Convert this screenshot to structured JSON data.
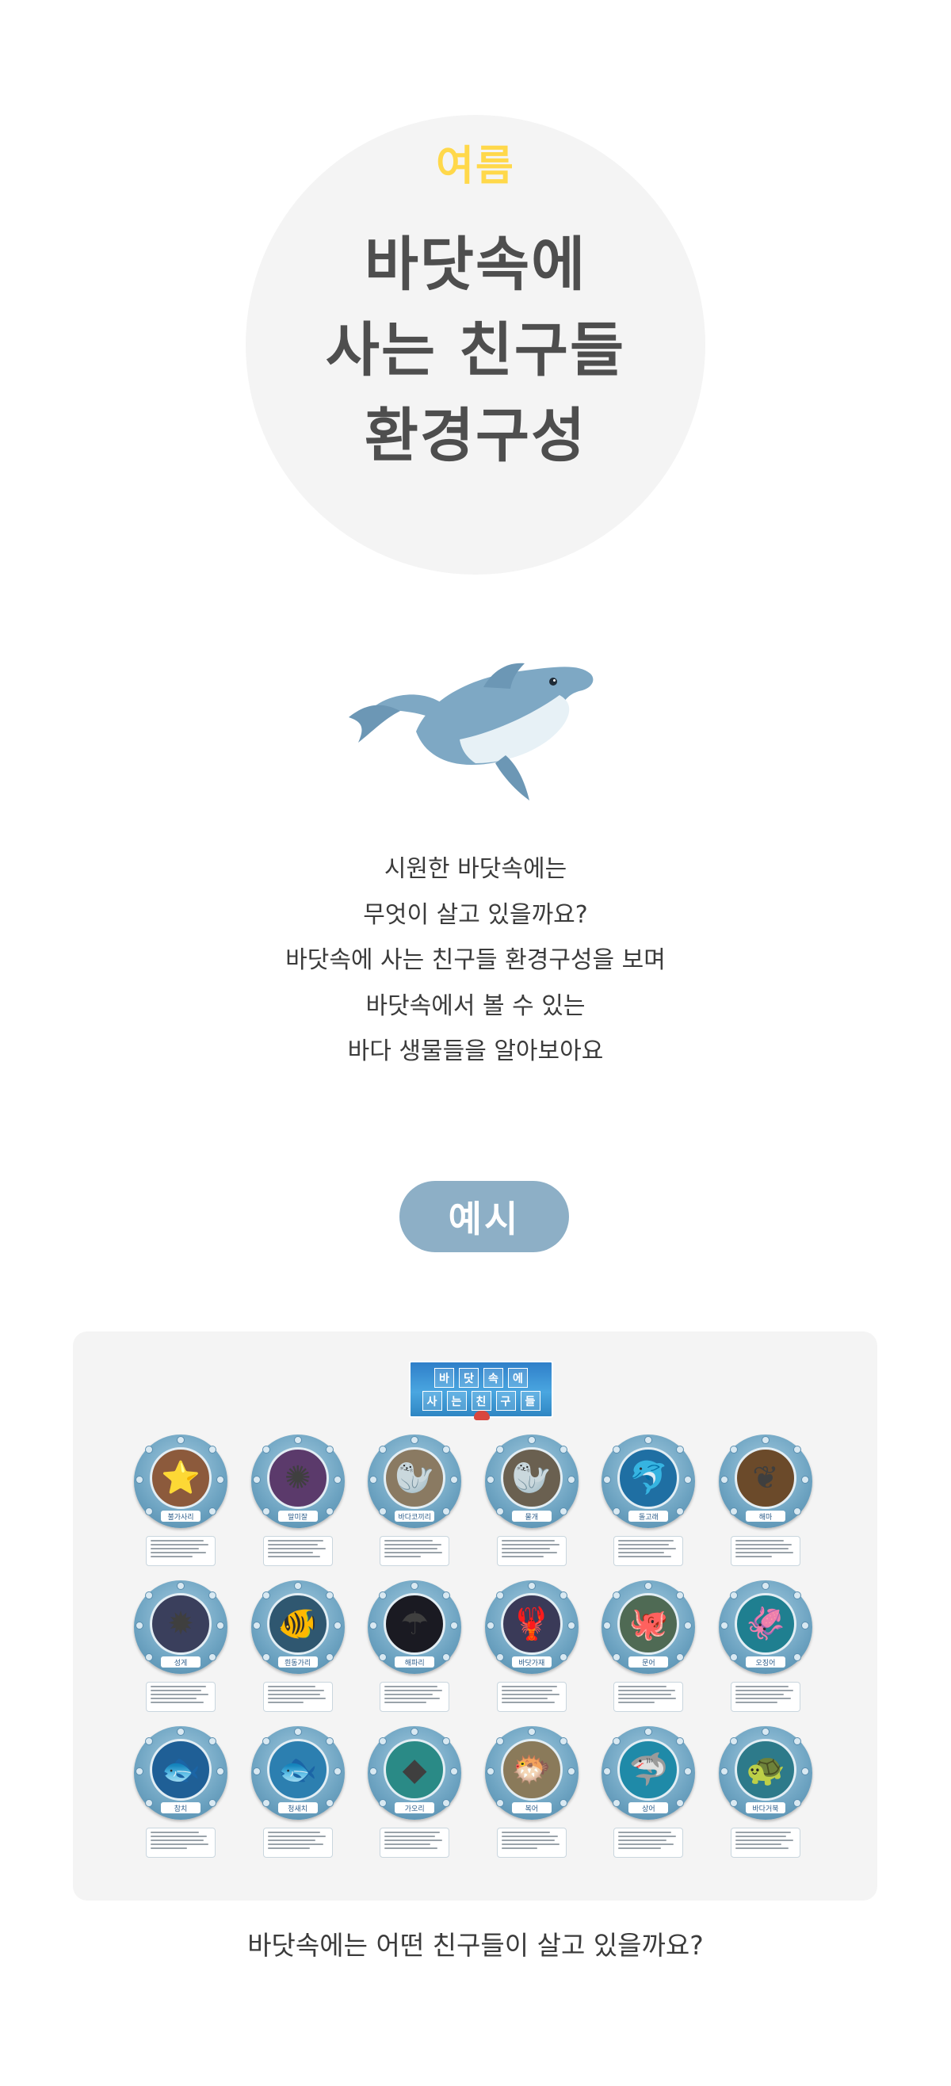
{
  "hero": {
    "season": "여름",
    "title_lines": [
      "바닷속에",
      "사는 친구들",
      "환경구성"
    ]
  },
  "intro": {
    "lines": [
      "시원한 바닷속에는",
      "무엇이 살고 있을까요?",
      "바닷속에 사는 친구들 환경구성을 보며",
      "바닷속에서 볼 수 있는",
      "바다 생물들을 알아보아요"
    ]
  },
  "example": {
    "label": "예시",
    "banner": {
      "line1": [
        "바",
        "닷",
        "속",
        "에"
      ],
      "line2": [
        "사",
        "는",
        "친",
        "구",
        "들"
      ]
    },
    "rows": [
      [
        {
          "label": "불가사리",
          "icon": "starfish-icon",
          "glyph": "⭐",
          "bg": "#8c5a3c"
        },
        {
          "label": "말미잘",
          "icon": "sea-anemone-icon",
          "glyph": "✺",
          "bg": "#5b3a6b"
        },
        {
          "label": "바다코끼리",
          "icon": "walrus-icon",
          "glyph": "🦭",
          "bg": "#8a7a62"
        },
        {
          "label": "물개",
          "icon": "seal-icon",
          "glyph": "🦭",
          "bg": "#6a6050"
        },
        {
          "label": "돌고래",
          "icon": "dolphin-icon",
          "glyph": "🐬",
          "bg": "#1f6fa3"
        },
        {
          "label": "해마",
          "icon": "seahorse-icon",
          "glyph": "❦",
          "bg": "#6b4a2a"
        }
      ],
      [
        {
          "label": "성게",
          "icon": "sea-urchin-icon",
          "glyph": "✹",
          "bg": "#3a3f5c"
        },
        {
          "label": "흰동가리",
          "icon": "clownfish-icon",
          "glyph": "🐠",
          "bg": "#2f5770"
        },
        {
          "label": "해파리",
          "icon": "jellyfish-icon",
          "glyph": "☂",
          "bg": "#1a1a22"
        },
        {
          "label": "바닷가재",
          "icon": "lobster-icon",
          "glyph": "🦞",
          "bg": "#3a3a58"
        },
        {
          "label": "문어",
          "icon": "octopus-icon",
          "glyph": "🐙",
          "bg": "#4f6a54"
        },
        {
          "label": "오징어",
          "icon": "squid-icon",
          "glyph": "🦑",
          "bg": "#1f7f90"
        }
      ],
      [
        {
          "label": "참치",
          "icon": "tuna-icon",
          "glyph": "🐟",
          "bg": "#1f5f96"
        },
        {
          "label": "청새치",
          "icon": "marlin-icon",
          "glyph": "🐟",
          "bg": "#2c7fb0"
        },
        {
          "label": "가오리",
          "icon": "stingray-icon",
          "glyph": "◆",
          "bg": "#2a8a86"
        },
        {
          "label": "복어",
          "icon": "pufferfish-icon",
          "glyph": "🐡",
          "bg": "#8a7a5a"
        },
        {
          "label": "상어",
          "icon": "shark-icon",
          "glyph": "🦈",
          "bg": "#1f8aa8"
        },
        {
          "label": "바다거북",
          "icon": "sea-turtle-icon",
          "glyph": "🐢",
          "bg": "#2d7a8a"
        }
      ]
    ]
  },
  "footer_question": "바닷속에는 어떤 친구들이 살고 있을까요?"
}
